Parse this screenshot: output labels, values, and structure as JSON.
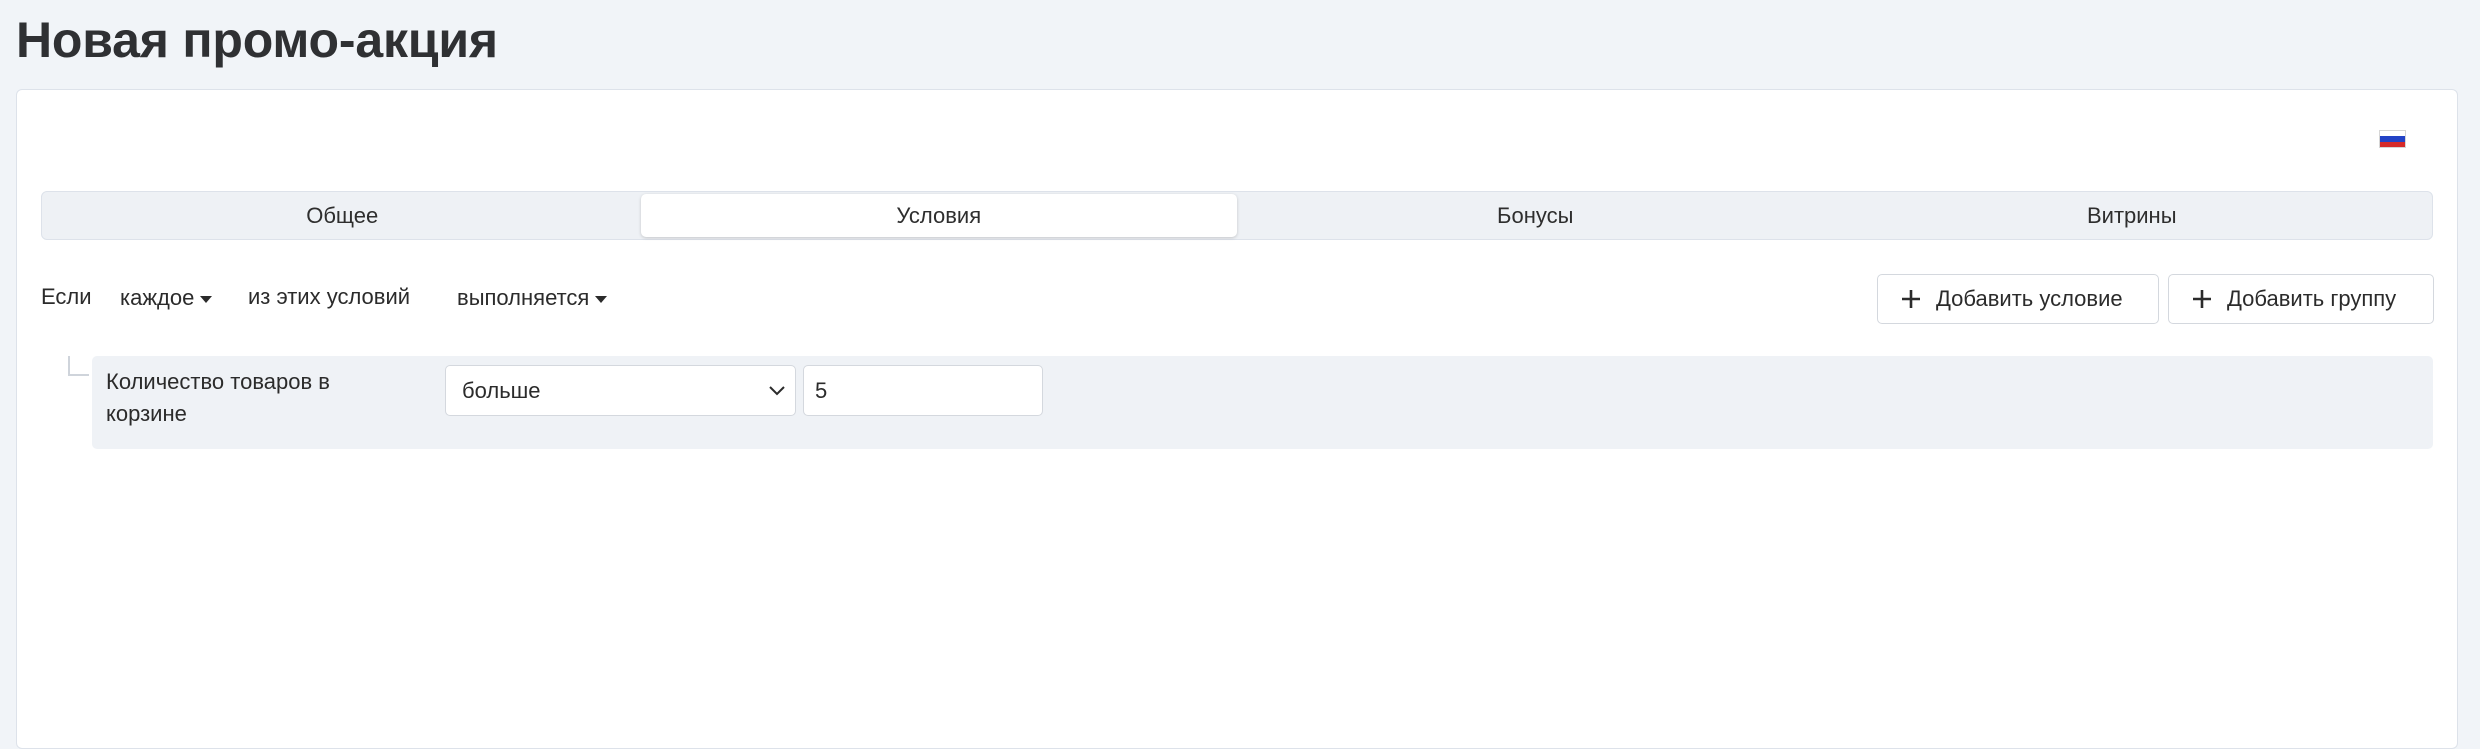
{
  "page": {
    "title": "Новая промо-акция"
  },
  "language_flag": {
    "icon": "russia-flag-icon",
    "colors": [
      "#ffffff",
      "#2343c6",
      "#d52a2a"
    ]
  },
  "tabs": [
    {
      "label": "Общее",
      "active": false
    },
    {
      "label": "Условия",
      "active": true
    },
    {
      "label": "Бонусы",
      "active": false
    },
    {
      "label": "Витрины",
      "active": false
    }
  ],
  "conditions": {
    "if_label": "Если",
    "quantifier": "каждое",
    "middle_label": "из этих условий",
    "state": "выполняется",
    "add_condition_label": "Добавить условие",
    "add_group_label": "Добавить группу"
  },
  "rule": {
    "label": "Количество товаров в корзине",
    "operator": "больше",
    "value": "5"
  }
}
